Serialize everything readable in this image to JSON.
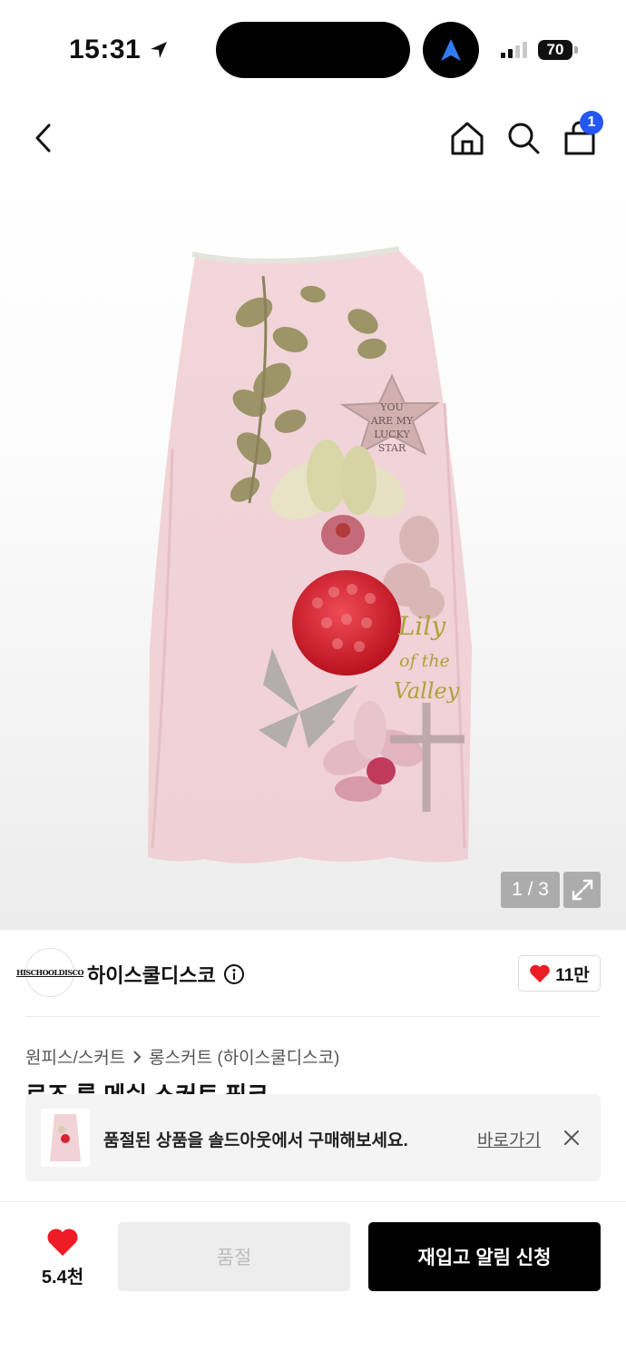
{
  "status_bar": {
    "time": "15:31",
    "battery": "70"
  },
  "nav": {
    "cart_count": "1"
  },
  "hero": {
    "image_index": "1 / 3",
    "skirt_print": {
      "star_text": [
        "YOU",
        "ARE MY",
        "LUCKY",
        "STAR"
      ],
      "script_text": [
        "Lily",
        "of the",
        "Valley"
      ]
    },
    "colors": {
      "skirt": "#f1d4d8",
      "raspberry": "#d7232e"
    }
  },
  "brand": {
    "logo_text": "HISCHOOLDISCO",
    "name": "하이스쿨디스코",
    "likes": "11만"
  },
  "breadcrumb": {
    "category": "원피스/스커트",
    "subcategory": "롱스커트 (하이스쿨디스코)"
  },
  "product": {
    "title": "로즈 룩 메쉬 스커트 핑크"
  },
  "soldout_banner": {
    "text": "품절된 상품을 솔드아웃에서 구매해보세요.",
    "link": "바로가기"
  },
  "bottom_bar": {
    "like_count": "5.4천",
    "soldout_label": "품절",
    "restock_label": "재입고 알림 신청"
  },
  "accent_colors": {
    "badge": "#2457f5",
    "heart": "#ee1c25"
  }
}
